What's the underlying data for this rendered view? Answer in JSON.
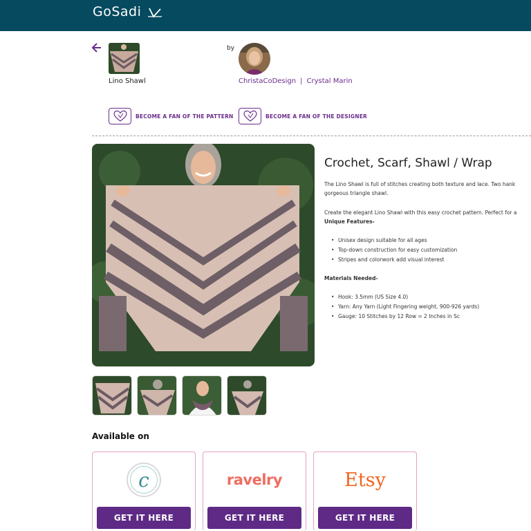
{
  "header": {
    "logo_text": "GoSadi",
    "background": "#054a5e"
  },
  "pattern": {
    "name": "Lino Shawl"
  },
  "designer": {
    "by_label": "by",
    "name": "ChristaCoDesign",
    "separator": "|",
    "person": "Crystal Marin"
  },
  "fan_buttons": {
    "pattern_label": "BECOME A FAN OF THE PATTERN",
    "designer_label": "BECOME A FAN OF THE DESIGNER"
  },
  "details": {
    "title": "Crochet, Scarf, Shawl / Wrap",
    "intro_line1": "The Lino Shawl is full of stitches creating both texture and lace. Two hank",
    "intro_line2": "gorgeous triangle shawl.",
    "create_line": "Create the elegant Lino Shawl with this easy crochet pattern. Perfect for a",
    "features_heading": "Unique Features-",
    "features": [
      "Unisex design suitable for all ages",
      "Top-down construction for easy customization",
      "Stripes and colorwork add visual interest"
    ],
    "materials_heading": "Materials Needed-",
    "materials": [
      "Hook: 3.5mm (US Size 4.0)",
      "Yarn: Any Yarn (Light Fingering weight, 900-926 yards)",
      "Gauge: 10 Stitches by 12 Row = 2 Inches in Sc"
    ]
  },
  "available": {
    "heading": "Available on",
    "stores": [
      {
        "name": "ChristaCoDesign",
        "button": "GET IT HERE",
        "logo": "c-circle-logo"
      },
      {
        "name": "ravelry",
        "button": "GET IT HERE",
        "logo": "ravelry-logo"
      },
      {
        "name": "Etsy",
        "button": "GET IT HERE",
        "logo": "etsy-logo"
      }
    ],
    "button_color": "#5e2a86"
  },
  "accent_color": "#6a2d8c"
}
